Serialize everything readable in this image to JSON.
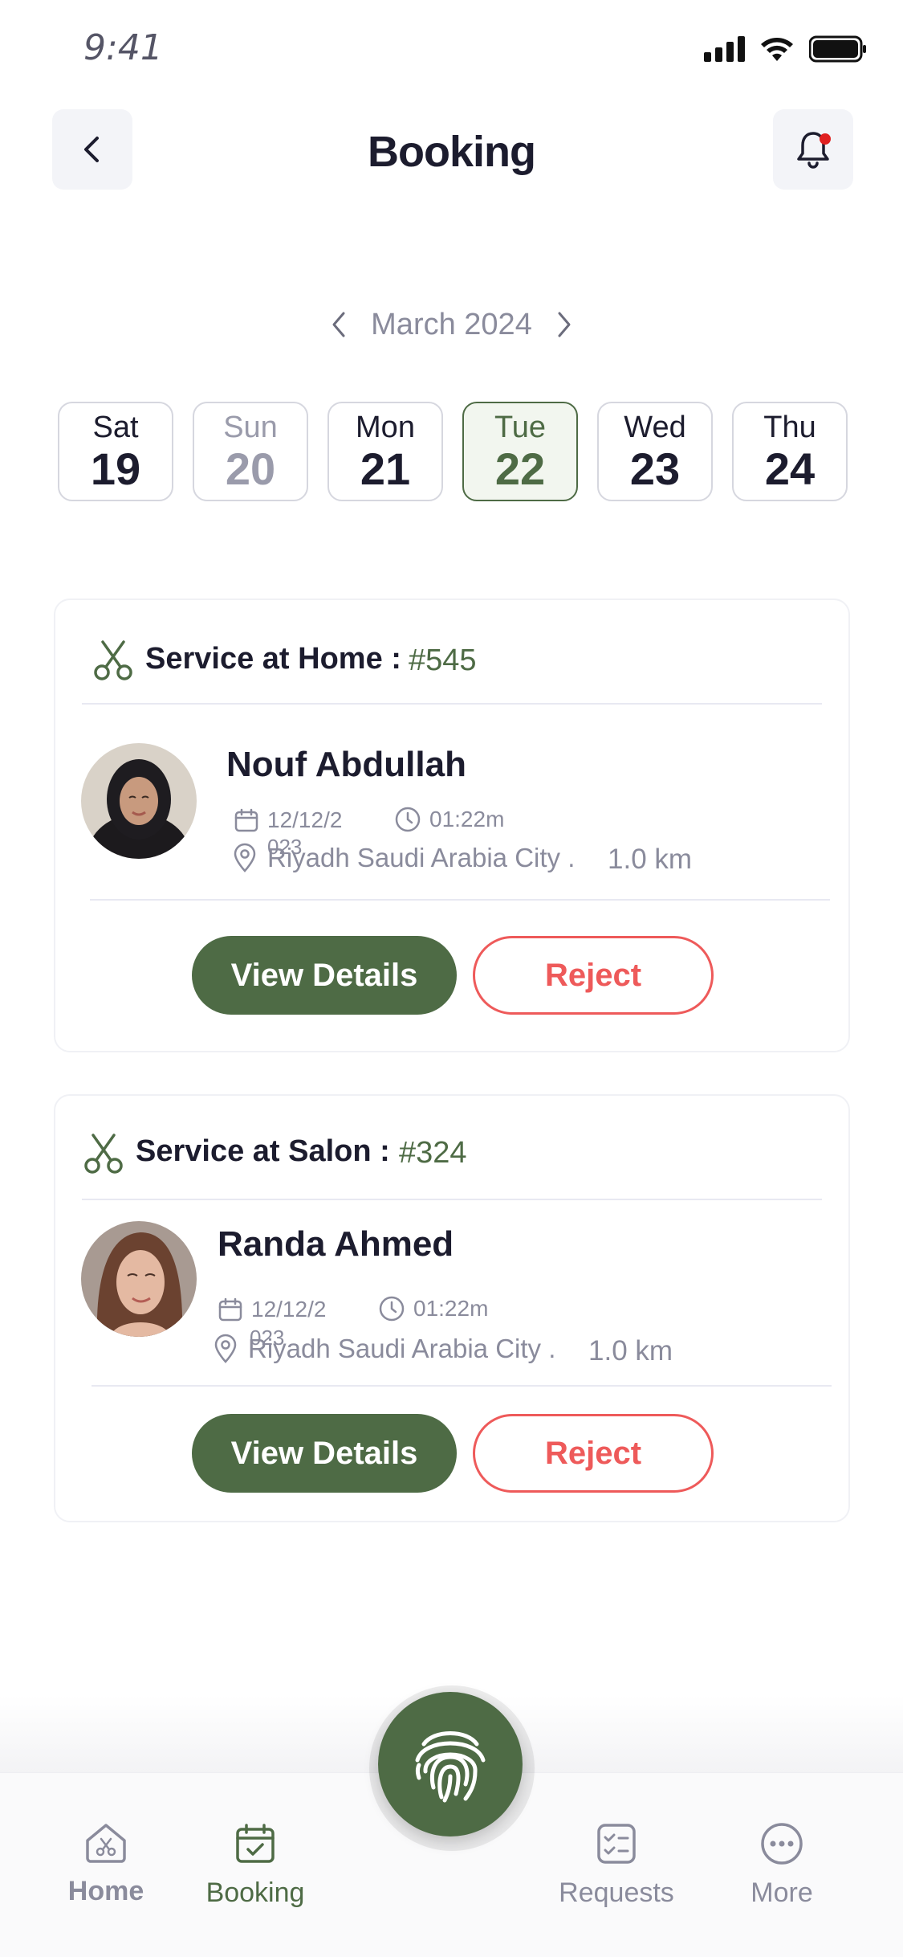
{
  "status_bar": {
    "time": "9:41"
  },
  "header": {
    "title": "Booking"
  },
  "calendar": {
    "month": "March 2024",
    "days": [
      {
        "name": "Sat",
        "num": "19",
        "state": "normal"
      },
      {
        "name": "Sun",
        "num": "20",
        "state": "muted"
      },
      {
        "name": "Mon",
        "num": "21",
        "state": "normal"
      },
      {
        "name": "Tue",
        "num": "22",
        "state": "selected"
      },
      {
        "name": "Wed",
        "num": "23",
        "state": "normal"
      },
      {
        "name": "Thu",
        "num": "24",
        "state": "normal"
      }
    ]
  },
  "bookings": [
    {
      "service_label": "Service at Home :",
      "code": "#545",
      "client": "Nouf Abdullah",
      "date_line1": "12/12/2",
      "date_line2": "023",
      "time": "01:22m",
      "location": "Riyadh Saudi Arabia City .",
      "distance": "1.0 km",
      "view_label": "View Details",
      "reject_label": "Reject"
    },
    {
      "service_label": "Service at Salon :",
      "code": "#324",
      "client": "Randa Ahmed",
      "date_line1": "12/12/2",
      "date_line2": "023",
      "time": "01:22m",
      "location": "Riyadh Saudi Arabia City .",
      "distance": "1.0 km",
      "view_label": "View Details",
      "reject_label": "Reject"
    }
  ],
  "bottom_nav": {
    "items": [
      {
        "label": "Home",
        "icon": "home-scissors-icon"
      },
      {
        "label": "Booking",
        "icon": "calendar-check-icon"
      },
      {
        "label": "Requests",
        "icon": "checklist-icon"
      },
      {
        "label": "More",
        "icon": "more-dots-icon"
      }
    ],
    "center_button_icon": "fingerprint-icon"
  },
  "colors": {
    "accent_green": "#4e6b45",
    "reject_red": "#ee5a5a",
    "notification_dot": "#e02020",
    "muted_text": "#8a8b9c"
  }
}
